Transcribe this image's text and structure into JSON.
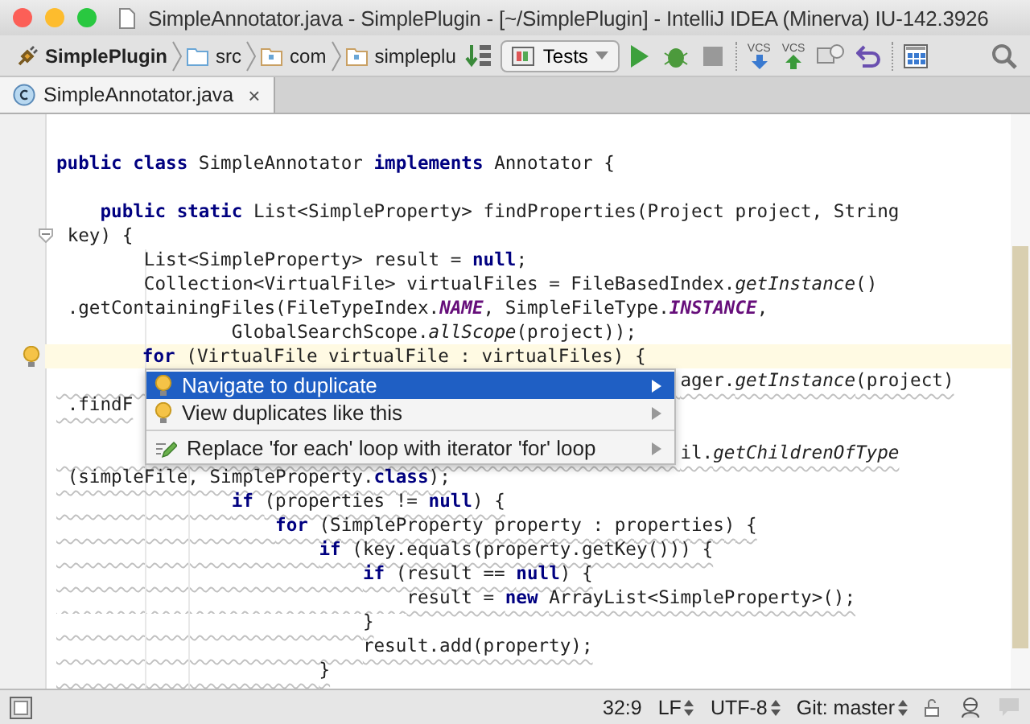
{
  "window": {
    "title": "SimpleAnnotator.java - SimplePlugin - [~/SimplePlugin] - IntelliJ IDEA (Minerva) IU-142.3926"
  },
  "breadcrumbs": [
    {
      "label": "SimplePlugin",
      "kind": "project"
    },
    {
      "label": "src",
      "kind": "source"
    },
    {
      "label": "com",
      "kind": "package"
    },
    {
      "label": "simpleplu",
      "kind": "package"
    }
  ],
  "run_config": {
    "label": "Tests"
  },
  "vcs_buttons": [
    {
      "label": "VCS",
      "kind": "update"
    },
    {
      "label": "VCS",
      "kind": "commit"
    }
  ],
  "tabs": [
    {
      "label": "SimpleAnnotator.java",
      "selected": true,
      "close": "×"
    }
  ],
  "code_lines": [
    {
      "kind": "blank"
    },
    {
      "segments": [
        {
          "text": "public class ",
          "kind": "keyword"
        },
        {
          "text": "SimpleAnnotator ",
          "kind": "plain"
        },
        {
          "text": "implements ",
          "kind": "keyword"
        },
        {
          "text": "Annotator {",
          "kind": "plain"
        }
      ]
    },
    {
      "kind": "blank"
    },
    {
      "segments": [
        {
          "text": "    public static ",
          "kind": "keyword"
        },
        {
          "text": "List<SimpleProperty> findProperties(Project project, String",
          "kind": "plain"
        }
      ]
    },
    {
      "fold": true,
      "segments": [
        {
          "text": " key) {",
          "kind": "plain"
        }
      ]
    },
    {
      "segments": [
        {
          "text": "        List<SimpleProperty> result = ",
          "kind": "plain"
        },
        {
          "text": "null",
          "kind": "keyword"
        },
        {
          "text": ";",
          "kind": "plain"
        }
      ]
    },
    {
      "segments": [
        {
          "text": "        Collection<VirtualFile> virtualFiles = FileBasedIndex.",
          "kind": "plain"
        },
        {
          "text": "getInstance",
          "kind": "static"
        },
        {
          "text": "()",
          "kind": "plain"
        }
      ]
    },
    {
      "segments": [
        {
          "text": " .getContainingFiles(FileTypeIndex.",
          "kind": "plain"
        },
        {
          "text": "NAME",
          "kind": "constant"
        },
        {
          "text": ", SimpleFileType.",
          "kind": "plain"
        },
        {
          "text": "INSTANCE",
          "kind": "constant"
        },
        {
          "text": ",",
          "kind": "plain"
        }
      ]
    },
    {
      "segments": [
        {
          "text": "                GlobalSearchScope.",
          "kind": "plain"
        },
        {
          "text": "allScope",
          "kind": "static"
        },
        {
          "text": "(project));",
          "kind": "plain"
        }
      ]
    },
    {
      "current": true,
      "bulb": true,
      "segments": [
        {
          "text": "        for ",
          "kind": "keyword"
        },
        {
          "text": "(VirtualFile virtualFile : virtualFiles) {",
          "kind": "plain"
        }
      ]
    },
    {
      "duplicate": true,
      "segments": [
        {
          "text": "                                                         ager.",
          "kind": "plain"
        },
        {
          "text": "getInstance",
          "kind": "static"
        },
        {
          "text": "(project)",
          "kind": "plain"
        }
      ]
    },
    {
      "duplicate": true,
      "segments": [
        {
          "text": " .findF",
          "kind": "plain"
        }
      ]
    },
    {
      "kind": "blank"
    },
    {
      "duplicate": true,
      "segments": [
        {
          "text": "                                                         il.",
          "kind": "plain"
        },
        {
          "text": "getChildrenOfType",
          "kind": "static"
        }
      ]
    },
    {
      "duplicate": true,
      "segments": [
        {
          "text": " (simpleFile, SimpleProperty.",
          "kind": "plain"
        },
        {
          "text": "class",
          "kind": "keyword"
        },
        {
          "text": ");",
          "kind": "plain"
        }
      ]
    },
    {
      "duplicate": true,
      "segments": [
        {
          "text": "                if ",
          "kind": "keyword"
        },
        {
          "text": "(properties != ",
          "kind": "plain"
        },
        {
          "text": "null",
          "kind": "keyword"
        },
        {
          "text": ") {",
          "kind": "plain"
        }
      ]
    },
    {
      "duplicate": true,
      "segments": [
        {
          "text": "                    for ",
          "kind": "keyword"
        },
        {
          "text": "(SimpleProperty property : properties) {",
          "kind": "plain"
        }
      ]
    },
    {
      "duplicate": true,
      "segments": [
        {
          "text": "                        if ",
          "kind": "keyword"
        },
        {
          "text": "(key.equals(property.getKey())) {",
          "kind": "plain"
        }
      ]
    },
    {
      "duplicate": true,
      "segments": [
        {
          "text": "                            if ",
          "kind": "keyword"
        },
        {
          "text": "(result == ",
          "kind": "plain"
        },
        {
          "text": "null",
          "kind": "keyword"
        },
        {
          "text": ") {",
          "kind": "plain"
        }
      ]
    },
    {
      "duplicate": true,
      "segments": [
        {
          "text": "                                result = ",
          "kind": "plain"
        },
        {
          "text": "new ",
          "kind": "keyword"
        },
        {
          "text": "ArrayList<SimpleProperty>();",
          "kind": "plain"
        }
      ]
    },
    {
      "duplicate": true,
      "segments": [
        {
          "text": "                            }",
          "kind": "plain"
        }
      ]
    },
    {
      "duplicate": true,
      "segments": [
        {
          "text": "                            result.add(property);",
          "kind": "plain"
        }
      ]
    },
    {
      "duplicate": true,
      "segments": [
        {
          "text": "                        }",
          "kind": "plain"
        }
      ]
    }
  ],
  "intention_menu": [
    {
      "label": "Navigate to duplicate",
      "kind": "bulb",
      "selected": true
    },
    {
      "label": "View duplicates like this",
      "kind": "bulb",
      "selected": false
    },
    {
      "label": "Replace 'for each' loop with iterator 'for' loop",
      "kind": "pencil",
      "selected": false
    }
  ],
  "status_bar": {
    "position": "32:9",
    "line_separator": "LF",
    "encoding": "UTF-8",
    "vcs_branch": "Git: master"
  }
}
